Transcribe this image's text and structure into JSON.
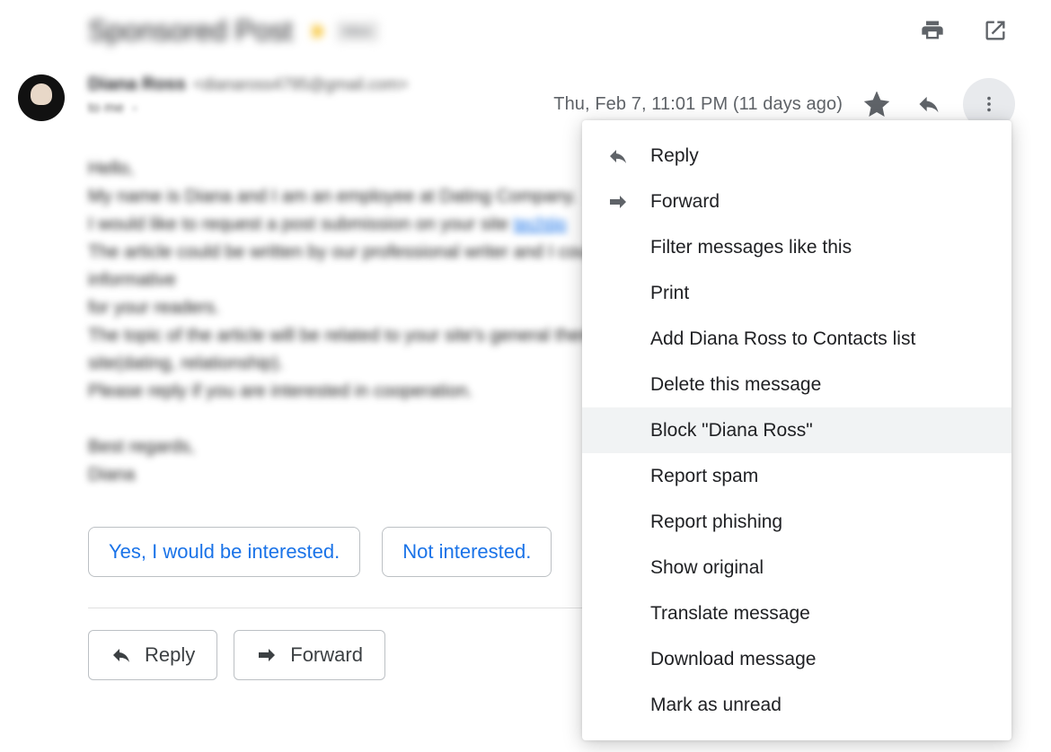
{
  "subject": "Sponsored Post",
  "category_label": "Inbox",
  "sender": {
    "name": "Diana Ross",
    "email": "<dianaross4795@gmail.com>"
  },
  "recipient_line": "to me",
  "timestamp": "Thu, Feb 7, 11:01 PM (11 days ago)",
  "body_lines": [
    "Hello,",
    "My name is Diana and I am an employee at Dating Company.",
    "I would like to request a post submission on your site",
    "The article could be written by our professional writer and I could make sure such article would be very informative",
    "for your readers.",
    "The topic of the article will be related to your site's general theme and at the same time it will relate to our",
    "site(dating, relationship).",
    "Please reply if you are interested in cooperation.",
    "",
    "Best regards,",
    "Diana"
  ],
  "body_link_text": "techtip",
  "smart_replies": [
    "Yes, I would be interested.",
    "Not interested."
  ],
  "action_buttons": {
    "reply": "Reply",
    "forward": "Forward"
  },
  "menu_items": [
    {
      "label": "Reply",
      "icon": "reply"
    },
    {
      "label": "Forward",
      "icon": "forward"
    },
    {
      "label": "Filter messages like this"
    },
    {
      "label": "Print"
    },
    {
      "label": "Add Diana Ross to Contacts list"
    },
    {
      "label": "Delete this message"
    },
    {
      "label": "Block \"Diana Ross\"",
      "hover": true
    },
    {
      "label": "Report spam"
    },
    {
      "label": "Report phishing"
    },
    {
      "label": "Show original"
    },
    {
      "label": "Translate message"
    },
    {
      "label": "Download message"
    },
    {
      "label": "Mark as unread"
    }
  ]
}
